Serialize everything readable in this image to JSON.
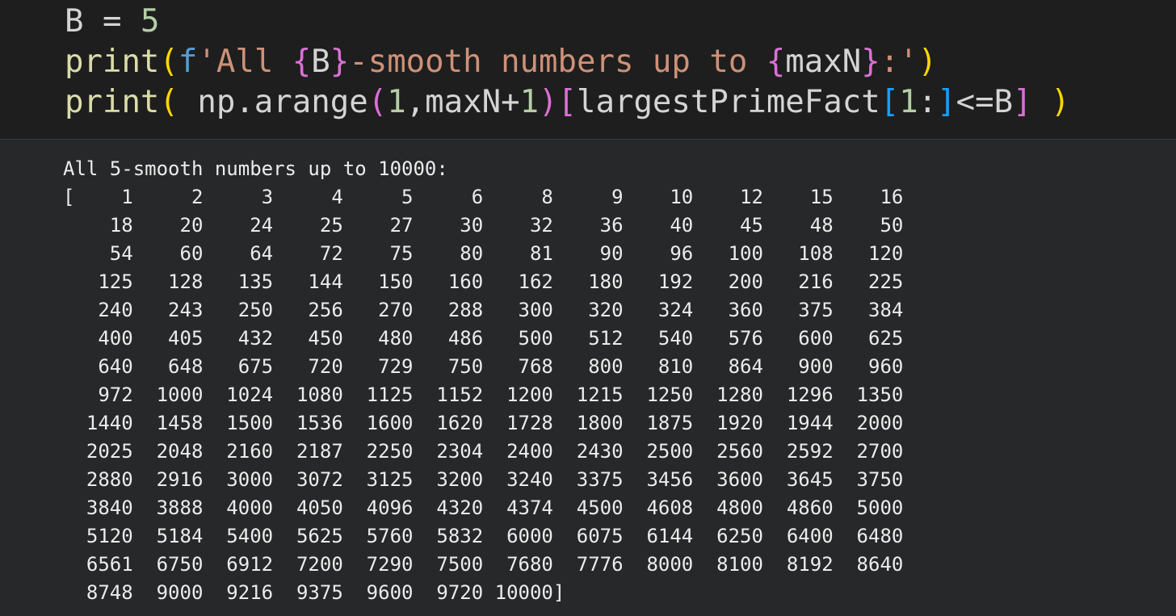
{
  "code_lines": [
    [
      {
        "t": "B",
        "c": "tok-var"
      },
      {
        "t": " = ",
        "c": "tok-op"
      },
      {
        "t": "5",
        "c": "tok-num"
      }
    ],
    [
      {
        "t": "print",
        "c": "tok-fn"
      },
      {
        "t": "(",
        "c": "p-yellow"
      },
      {
        "t": "f",
        "c": "tok-kw"
      },
      {
        "t": "'All ",
        "c": "tok-str"
      },
      {
        "t": "{",
        "c": "p-pink"
      },
      {
        "t": "B",
        "c": "tok-var"
      },
      {
        "t": "}",
        "c": "p-pink"
      },
      {
        "t": "-smooth numbers up to ",
        "c": "tok-str"
      },
      {
        "t": "{",
        "c": "p-pink"
      },
      {
        "t": "maxN",
        "c": "tok-var"
      },
      {
        "t": "}",
        "c": "p-pink"
      },
      {
        "t": ":'",
        "c": "tok-str"
      },
      {
        "t": ")",
        "c": "p-yellow"
      }
    ],
    [
      {
        "t": "print",
        "c": "tok-fn"
      },
      {
        "t": "(",
        "c": "p-yellow"
      },
      {
        "t": " np.arange",
        "c": "tok-var"
      },
      {
        "t": "(",
        "c": "p-pink"
      },
      {
        "t": "1",
        "c": "tok-num"
      },
      {
        "t": ",maxN+",
        "c": "tok-var"
      },
      {
        "t": "1",
        "c": "tok-num"
      },
      {
        "t": ")",
        "c": "p-pink"
      },
      {
        "t": "[",
        "c": "p-pink"
      },
      {
        "t": "largestPrimeFact",
        "c": "tok-var"
      },
      {
        "t": "[",
        "c": "p-blue"
      },
      {
        "t": "1",
        "c": "tok-num"
      },
      {
        "t": ":",
        "c": "tok-var"
      },
      {
        "t": "]",
        "c": "p-blue"
      },
      {
        "t": "<=B",
        "c": "tok-var"
      },
      {
        "t": "]",
        "c": "p-pink"
      },
      {
        "t": " ",
        "c": "tok-var"
      },
      {
        "t": ")",
        "c": "p-yellow"
      }
    ]
  ],
  "output": {
    "header": "All 5-smooth numbers up to 10000:",
    "rows": [
      "[    1     2     3     4     5     6     8     9    10    12    15    16",
      "    18    20    24    25    27    30    32    36    40    45    48    50",
      "    54    60    64    72    75    80    81    90    96   100   108   120",
      "   125   128   135   144   150   160   162   180   192   200   216   225",
      "   240   243   250   256   270   288   300   320   324   360   375   384",
      "   400   405   432   450   480   486   500   512   540   576   600   625",
      "   640   648   675   720   729   750   768   800   810   864   900   960",
      "   972  1000  1024  1080  1125  1152  1200  1215  1250  1280  1296  1350",
      "  1440  1458  1500  1536  1600  1620  1728  1800  1875  1920  1944  2000",
      "  2025  2048  2160  2187  2250  2304  2400  2430  2500  2560  2592  2700",
      "  2880  2916  3000  3072  3125  3200  3240  3375  3456  3600  3645  3750",
      "  3840  3888  4000  4050  4096  4320  4374  4500  4608  4800  4860  5000",
      "  5120  5184  5400  5625  5760  5832  6000  6075  6144  6250  6400  6480",
      "  6561  6750  6912  7200  7290  7500  7680  7776  8000  8100  8192  8640",
      "  8748  9000  9216  9375  9600  9720 10000]"
    ]
  }
}
